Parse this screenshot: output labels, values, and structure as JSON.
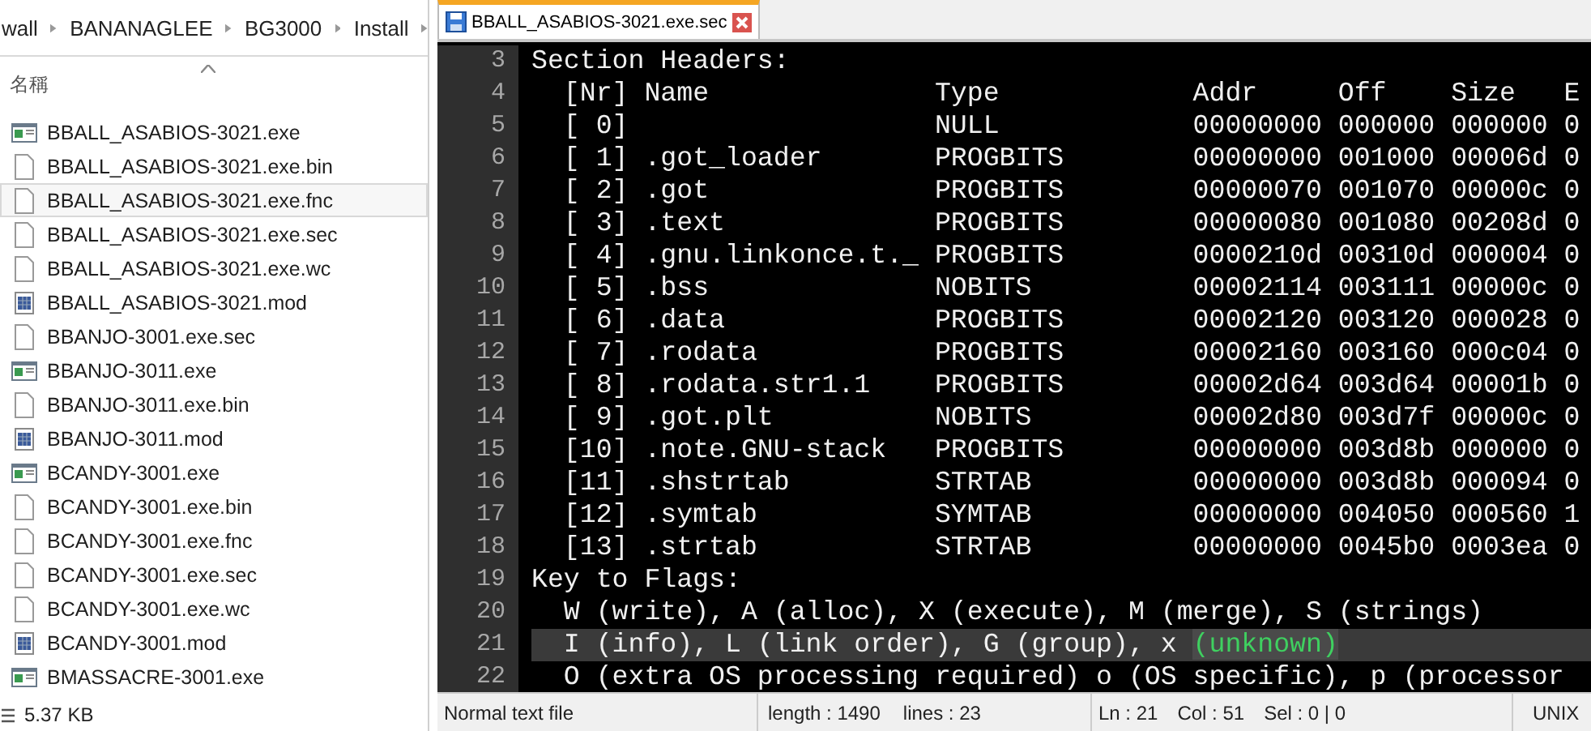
{
  "explorer": {
    "breadcrumb": [
      "wall",
      "BANANAGLEE",
      "BG3000",
      "Install"
    ],
    "column_header": "名稱",
    "files": [
      {
        "name": "BBALL_ASABIOS-3021.exe",
        "kind": "exe",
        "selected": false
      },
      {
        "name": "BBALL_ASABIOS-3021.exe.bin",
        "kind": "file",
        "selected": false
      },
      {
        "name": "BBALL_ASABIOS-3021.exe.fnc",
        "kind": "file",
        "selected": true
      },
      {
        "name": "BBALL_ASABIOS-3021.exe.sec",
        "kind": "file",
        "selected": false
      },
      {
        "name": "BBALL_ASABIOS-3021.exe.wc",
        "kind": "file",
        "selected": false
      },
      {
        "name": "BBALL_ASABIOS-3021.mod",
        "kind": "mod",
        "selected": false
      },
      {
        "name": "BBANJO-3001.exe.sec",
        "kind": "file",
        "selected": false
      },
      {
        "name": "BBANJO-3011.exe",
        "kind": "exe",
        "selected": false
      },
      {
        "name": "BBANJO-3011.exe.bin",
        "kind": "file",
        "selected": false
      },
      {
        "name": "BBANJO-3011.mod",
        "kind": "mod",
        "selected": false
      },
      {
        "name": "BCANDY-3001.exe",
        "kind": "exe",
        "selected": false
      },
      {
        "name": "BCANDY-3001.exe.bin",
        "kind": "file",
        "selected": false
      },
      {
        "name": "BCANDY-3001.exe.fnc",
        "kind": "file",
        "selected": false
      },
      {
        "name": "BCANDY-3001.exe.sec",
        "kind": "file",
        "selected": false
      },
      {
        "name": "BCANDY-3001.exe.wc",
        "kind": "file",
        "selected": false
      },
      {
        "name": "BCANDY-3001.mod",
        "kind": "mod",
        "selected": false
      },
      {
        "name": "BMASSACRE-3001.exe",
        "kind": "exe",
        "selected": false
      }
    ],
    "status": "5.37 KB"
  },
  "editor": {
    "tab": {
      "title": "BBALL_ASABIOS-3021.exe.sec",
      "selected": true
    },
    "lines": [
      {
        "num": "3",
        "text": "Section Headers:",
        "current": false
      },
      {
        "num": "4",
        "text": "  [Nr] Name              Type            Addr     Off    Size   E",
        "current": false
      },
      {
        "num": "5",
        "text": "  [ 0]                   NULL            00000000 000000 000000 0",
        "current": false
      },
      {
        "num": "6",
        "text": "  [ 1] .got_loader       PROGBITS        00000000 001000 00006d 0",
        "current": false
      },
      {
        "num": "7",
        "text": "  [ 2] .got              PROGBITS        00000070 001070 00000c 0",
        "current": false
      },
      {
        "num": "8",
        "text": "  [ 3] .text             PROGBITS        00000080 001080 00208d 0",
        "current": false
      },
      {
        "num": "9",
        "text": "  [ 4] .gnu.linkonce.t._ PROGBITS        0000210d 00310d 000004 0",
        "current": false
      },
      {
        "num": "10",
        "text": "  [ 5] .bss              NOBITS          00002114 003111 00000c 0",
        "current": false
      },
      {
        "num": "11",
        "text": "  [ 6] .data             PROGBITS        00002120 003120 000028 0",
        "current": false
      },
      {
        "num": "12",
        "text": "  [ 7] .rodata           PROGBITS        00002160 003160 000c04 0",
        "current": false
      },
      {
        "num": "13",
        "text": "  [ 8] .rodata.str1.1    PROGBITS        00002d64 003d64 00001b 0",
        "current": false
      },
      {
        "num": "14",
        "text": "  [ 9] .got.plt          NOBITS          00002d80 003d7f 00000c 0",
        "current": false
      },
      {
        "num": "15",
        "text": "  [10] .note.GNU-stack   PROGBITS        00000000 003d8b 000000 0",
        "current": false
      },
      {
        "num": "16",
        "text": "  [11] .shstrtab         STRTAB          00000000 003d8b 000094 0",
        "current": false
      },
      {
        "num": "17",
        "text": "  [12] .symtab           SYMTAB          00000000 004050 000560 1",
        "current": false
      },
      {
        "num": "18",
        "text": "  [13] .strtab           STRTAB          00000000 0045b0 0003ea 0",
        "current": false
      },
      {
        "num": "19",
        "text": "Key to Flags:",
        "current": false
      },
      {
        "num": "20",
        "text": "  W (write), A (alloc), X (execute), M (merge), S (strings)",
        "current": false
      },
      {
        "num": "21",
        "text": "  I (info), L (link order), G (group), x ",
        "match": "(unknown)",
        "current": true
      },
      {
        "num": "22",
        "text": "  O (extra OS processing required) o (OS specific), p (processor",
        "current": false
      }
    ],
    "status": {
      "file_type": "Normal text file",
      "length": "length : 1490",
      "lines": "lines : 23",
      "ln": "Ln : 21",
      "col": "Col : 51",
      "sel": "Sel : 0 | 0",
      "eol": "UNIX"
    }
  }
}
